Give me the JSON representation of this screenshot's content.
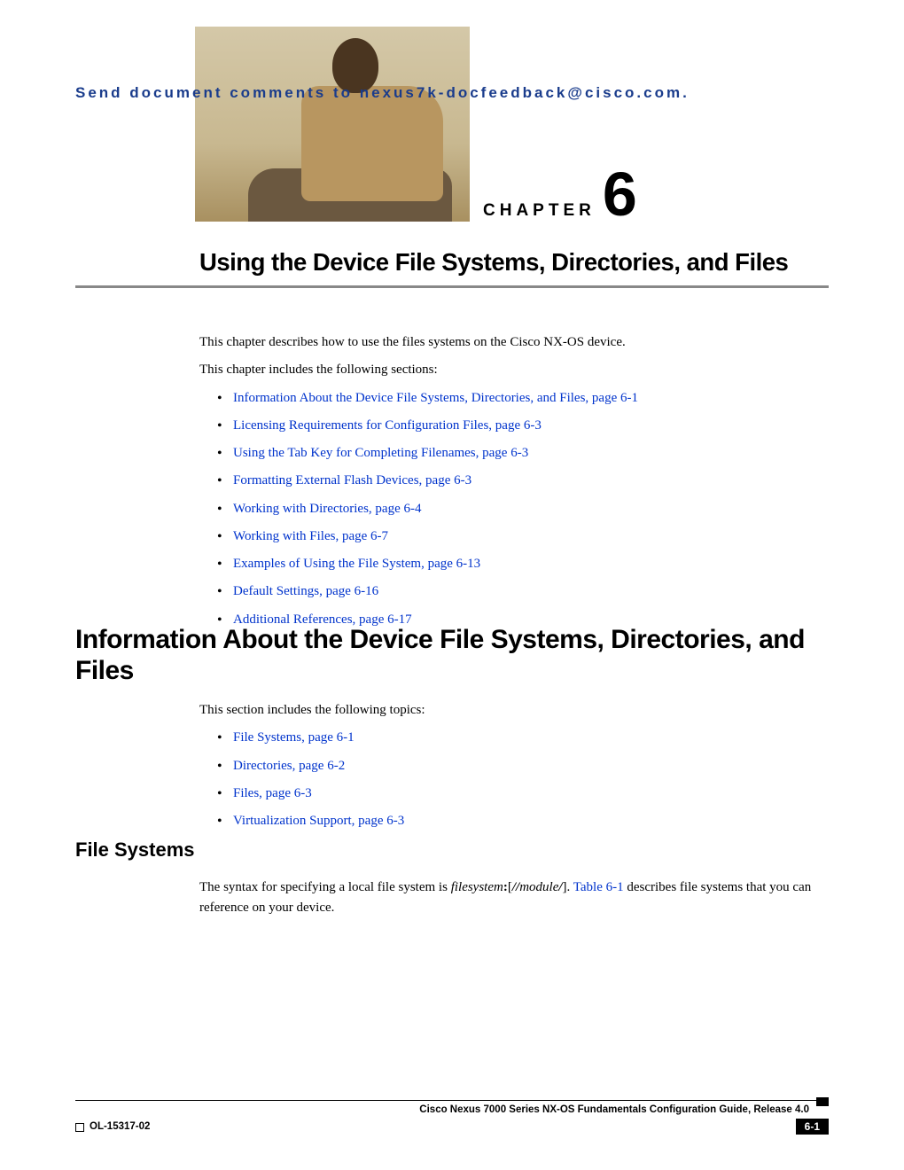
{
  "feedback_banner": "Send document comments to nexus7k-docfeedback@cisco.com.",
  "chapter_word": "CHAPTER",
  "chapter_number": "6",
  "chapter_title": "Using the Device File Systems, Directories, and Files",
  "intro": {
    "p1": "This chapter describes how to use the files systems on the Cisco NX-OS device.",
    "p2": "This chapter includes the following sections:",
    "links": [
      "Information About the Device File Systems, Directories, and Files, page 6-1",
      "Licensing Requirements for Configuration Files, page 6-3",
      "Using the Tab Key for Completing Filenames, page 6-3",
      "Formatting External Flash Devices, page 6-3",
      "Working with Directories, page 6-4",
      "Working with Files, page 6-7",
      "Examples of Using the File System, page 6-13",
      "Default Settings, page 6-16",
      "Additional References, page 6-17"
    ]
  },
  "section1": {
    "heading": "Information About the Device File Systems, Directories, and Files",
    "p1": "This section includes the following topics:",
    "links": [
      "File Systems, page 6-1",
      "Directories, page 6-2",
      "Files, page 6-3",
      "Virtualization Support, page 6-3"
    ]
  },
  "section2": {
    "heading": "File Systems",
    "syntax_pre": "The syntax for specifying a local file system is ",
    "syntax_fs": "filesystem",
    "syntax_colon": ":",
    "syntax_bracket_open": "[",
    "syntax_slash": "//",
    "syntax_module": "module",
    "syntax_slash2": "/",
    "syntax_bracket_close": "]. ",
    "table_ref": "Table 6-1",
    "syntax_post": " describes file systems that you can reference on your device."
  },
  "footer": {
    "book_title": "Cisco Nexus 7000 Series NX-OS Fundamentals Configuration Guide, Release 4.0",
    "doc_id": "OL-15317-02",
    "page_number": "6-1"
  }
}
